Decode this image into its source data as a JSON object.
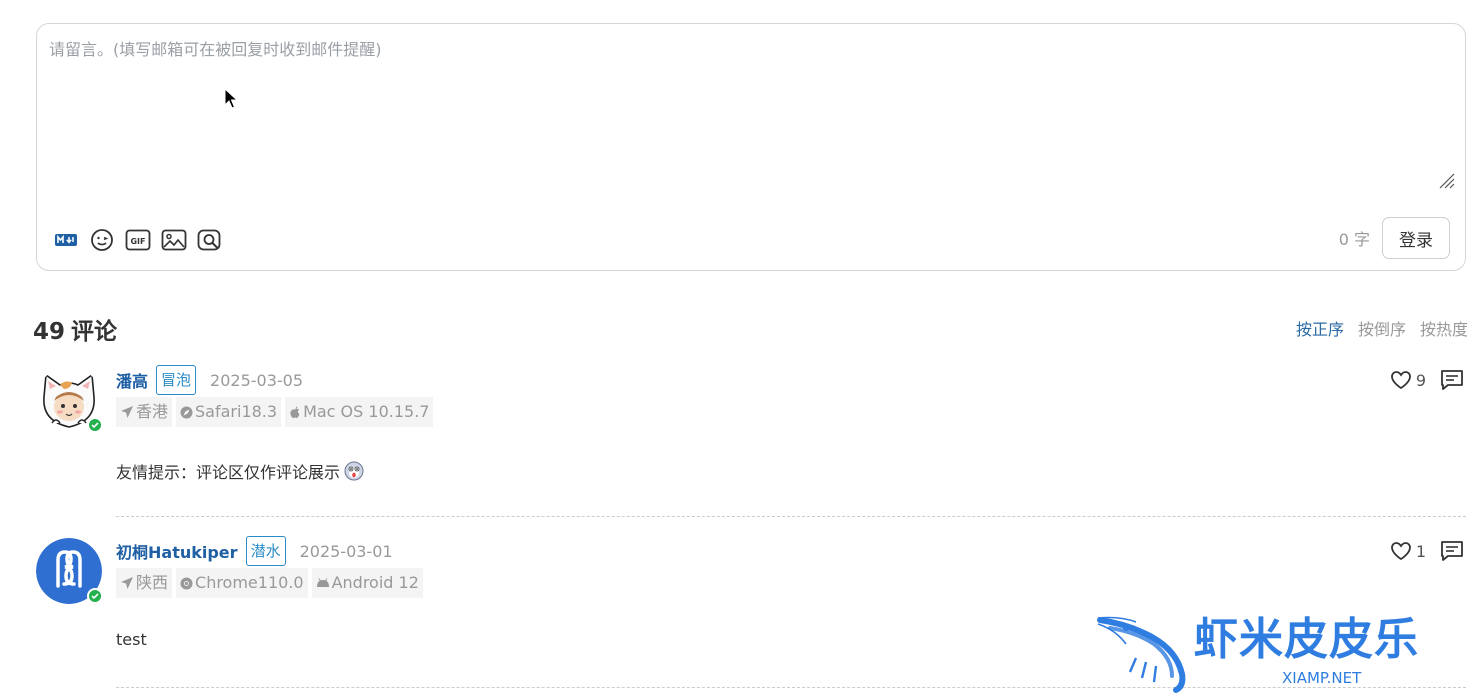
{
  "editor": {
    "placeholder": "请留言。(填写邮箱可在被回复时收到邮件提醒)",
    "word_count": "0 字",
    "login_label": "登录",
    "tools": [
      "markdown-icon",
      "emoji-icon",
      "gif-icon",
      "image-icon",
      "preview-icon"
    ]
  },
  "comments_header": {
    "count": "49",
    "label": "评论",
    "sort_tabs": [
      {
        "label": "按正序",
        "active": true
      },
      {
        "label": "按倒序",
        "active": false
      },
      {
        "label": "按热度",
        "active": false
      }
    ]
  },
  "comments": [
    {
      "nick": "潘高",
      "level": "冒泡",
      "date": "2025-03-05",
      "likes": "9",
      "location": "香港",
      "browser": "Safari18.3",
      "os": "Mac OS 10.15.7",
      "content": "友情提示：评论区仅作评论展示"
    },
    {
      "nick": "初桐Hatukiper",
      "level": "潜水",
      "date": "2025-03-01",
      "likes": "1",
      "location": "陕西",
      "browser": "Chrome110.0",
      "os": "Android 12",
      "content": "test"
    }
  ],
  "watermark": {
    "text": "虾米皮皮乐",
    "sub": "XIAMP.NET"
  },
  "colors": {
    "accent": "#1f5fa3",
    "level_border": "#2a8cc7",
    "verified": "#22b14c",
    "watermark": "#2f7de0"
  }
}
